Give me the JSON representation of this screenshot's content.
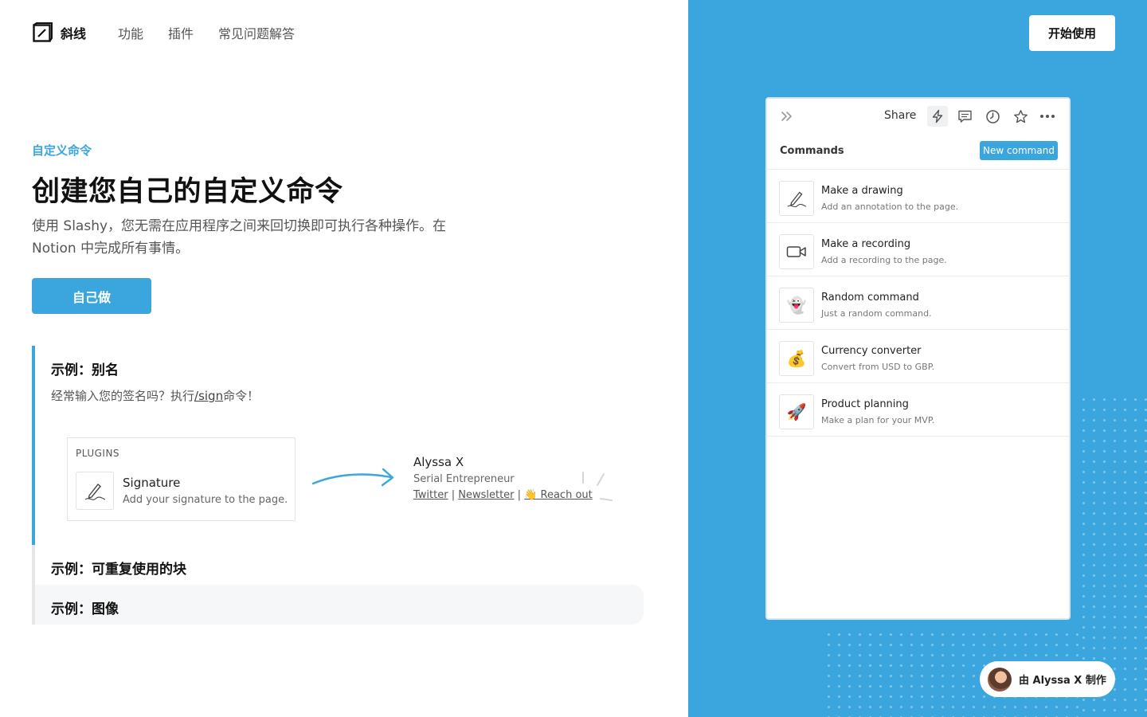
{
  "nav": {
    "logo_text": "斜线",
    "links": [
      "功能",
      "插件",
      "常见问题解答"
    ],
    "start_button": "开始使用"
  },
  "hero": {
    "eyebrow": "自定义命令",
    "headline": "创建您自己的自定义命令",
    "description": "使用 Slashy，您无需在应用程序之间来回切换即可执行各种操作。在 Notion 中完成所有事情。",
    "cta": "自己做"
  },
  "examples": {
    "active": {
      "title": "示例：别名",
      "sub_before": "经常输入您的签名吗？执行",
      "sub_command": "/sign",
      "sub_after": "命令！",
      "plugin_label": "PLUGINS",
      "plugin_name": "Signature",
      "plugin_desc": "Add your signature to the page.",
      "signature": {
        "name": "Alyssa X",
        "role": "Serial Entrepreneur",
        "link1": "Twitter",
        "link2": "Newsletter",
        "link3": "👋 Reach out",
        "separator": "|"
      }
    },
    "inactive": [
      "示例：可重复使用的块",
      "示例：图像"
    ]
  },
  "panel": {
    "share": "Share",
    "commands_header": "Commands",
    "new_command": "New command",
    "items": [
      {
        "title": "Make a drawing",
        "desc": "Add an annotation to the page.",
        "icon": "pencil-icon"
      },
      {
        "title": "Make a recording",
        "desc": "Add a recording to the page.",
        "icon": "video-camera-icon"
      },
      {
        "title": "Random command",
        "desc": "Just a random command.",
        "icon": "ghost-icon",
        "emoji": "👻"
      },
      {
        "title": "Currency converter",
        "desc": "Convert from USD to GBP.",
        "icon": "money-bag-icon",
        "emoji": "💰"
      },
      {
        "title": "Product planning",
        "desc": "Make a plan for your MVP.",
        "icon": "rocket-icon",
        "emoji": "🚀"
      }
    ]
  },
  "credit": {
    "text": "由 Alyssa X 制作"
  },
  "colors": {
    "accent": "#3aa6dd"
  }
}
